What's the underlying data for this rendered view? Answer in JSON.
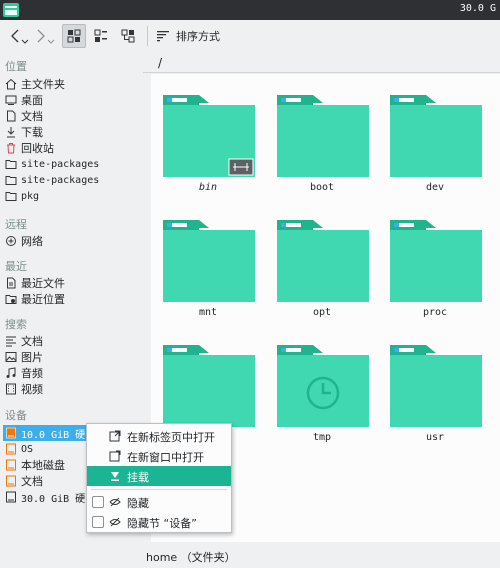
{
  "topbar": {
    "clock": "30.0 G"
  },
  "toolbar": {
    "sort_label": "排序方式"
  },
  "sidebar": {
    "places_header": "位置",
    "places": [
      "主文件夹",
      "桌面",
      "文档",
      "下载",
      "回收站",
      "site-packages",
      "site-packages",
      "pkg"
    ],
    "remote_header": "远程",
    "remote": [
      "网络"
    ],
    "recent_header": "最近",
    "recent": [
      "最近文件",
      "最近位置"
    ],
    "search_header": "搜索",
    "search": [
      "文档",
      "图片",
      "音频",
      "视频"
    ],
    "devices_header": "设备",
    "devices": [
      "10.0 GiB 硬",
      "OS",
      "本地磁盘",
      "文档",
      "30.0 GiB 硬"
    ]
  },
  "main": {
    "path": "/",
    "folders": [
      "bin",
      "boot",
      "dev",
      "mnt",
      "opt",
      "proc",
      "",
      "tmp",
      "usr"
    ]
  },
  "status": {
    "text": "home （文件夹）"
  },
  "context_menu": {
    "open_new_tab": "在新标签页中打开",
    "open_new_window": "在新窗口中打开",
    "mount": "挂载",
    "hide": "隐藏",
    "hide_section": "隐藏节 “设备”"
  },
  "colors": {
    "folder_body": "#3fd8b0",
    "folder_back": "#1fb38e",
    "highlight": "#1cb593",
    "selection": "#3daee9"
  }
}
